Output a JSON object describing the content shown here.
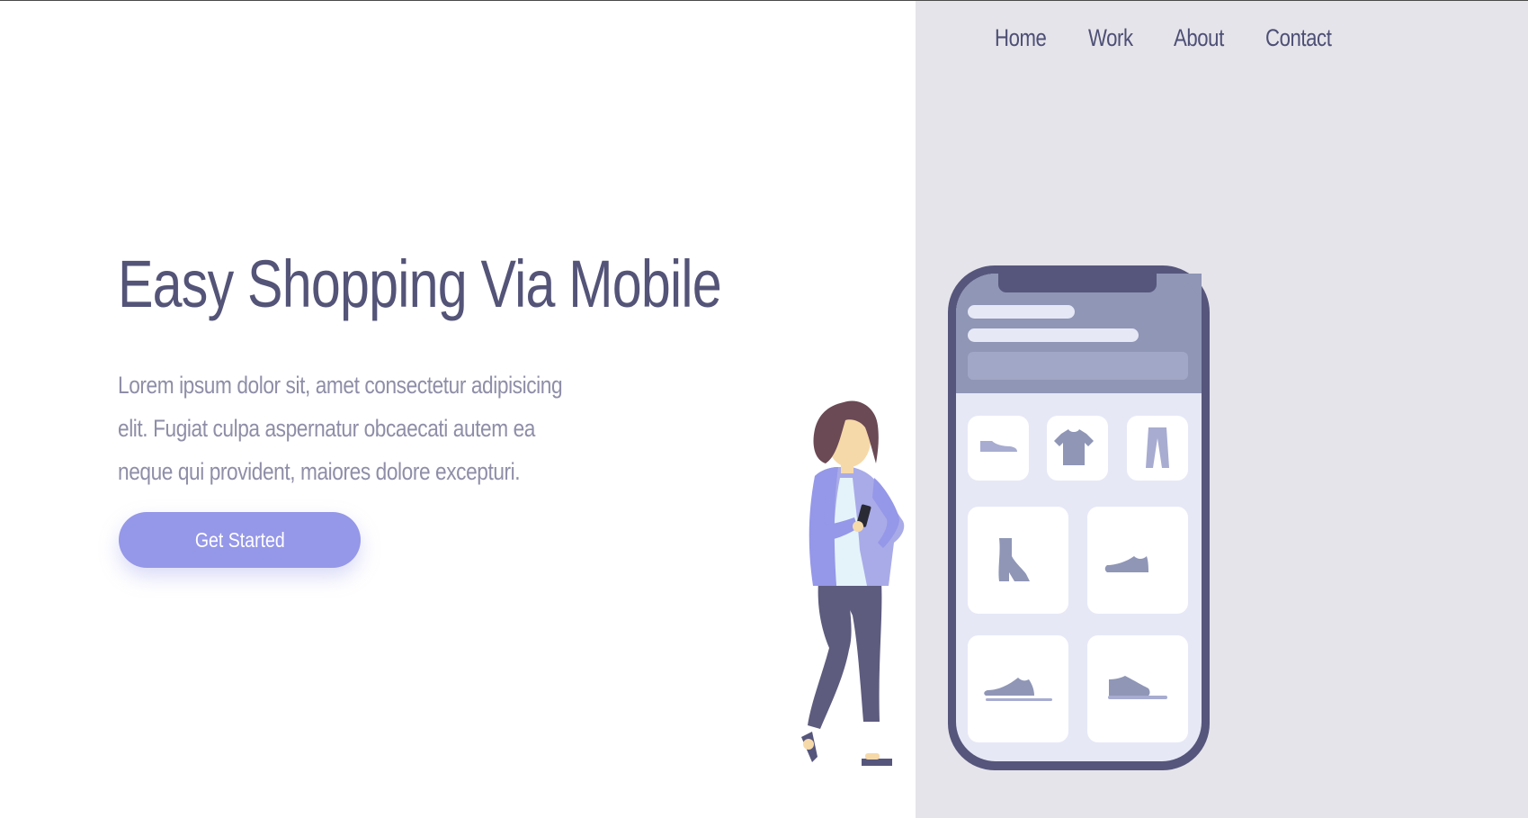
{
  "nav": {
    "items": [
      "Home",
      "Work",
      "About",
      "Contact"
    ]
  },
  "hero": {
    "title": "Easy Shopping Via Mobile",
    "description": "Lorem ipsum dolor sit, amet consectetur adipisicing elit. Fugiat culpa aspernatur obcaecati autem ea neque qui provident, maiores dolore excepturi.",
    "cta_label": "Get Started"
  },
  "colors": {
    "accent": "#9597e8",
    "heading": "#545478",
    "body_text": "#8e8ea8",
    "panel_bg": "#e5e4ea",
    "phone_frame": "#56567c"
  },
  "illustration": {
    "icons": [
      "flat-shoe-icon",
      "tshirt-icon",
      "pants-icon",
      "boot-icon",
      "sneaker-icon",
      "sneaker-icon",
      "sneaker-icon"
    ]
  }
}
